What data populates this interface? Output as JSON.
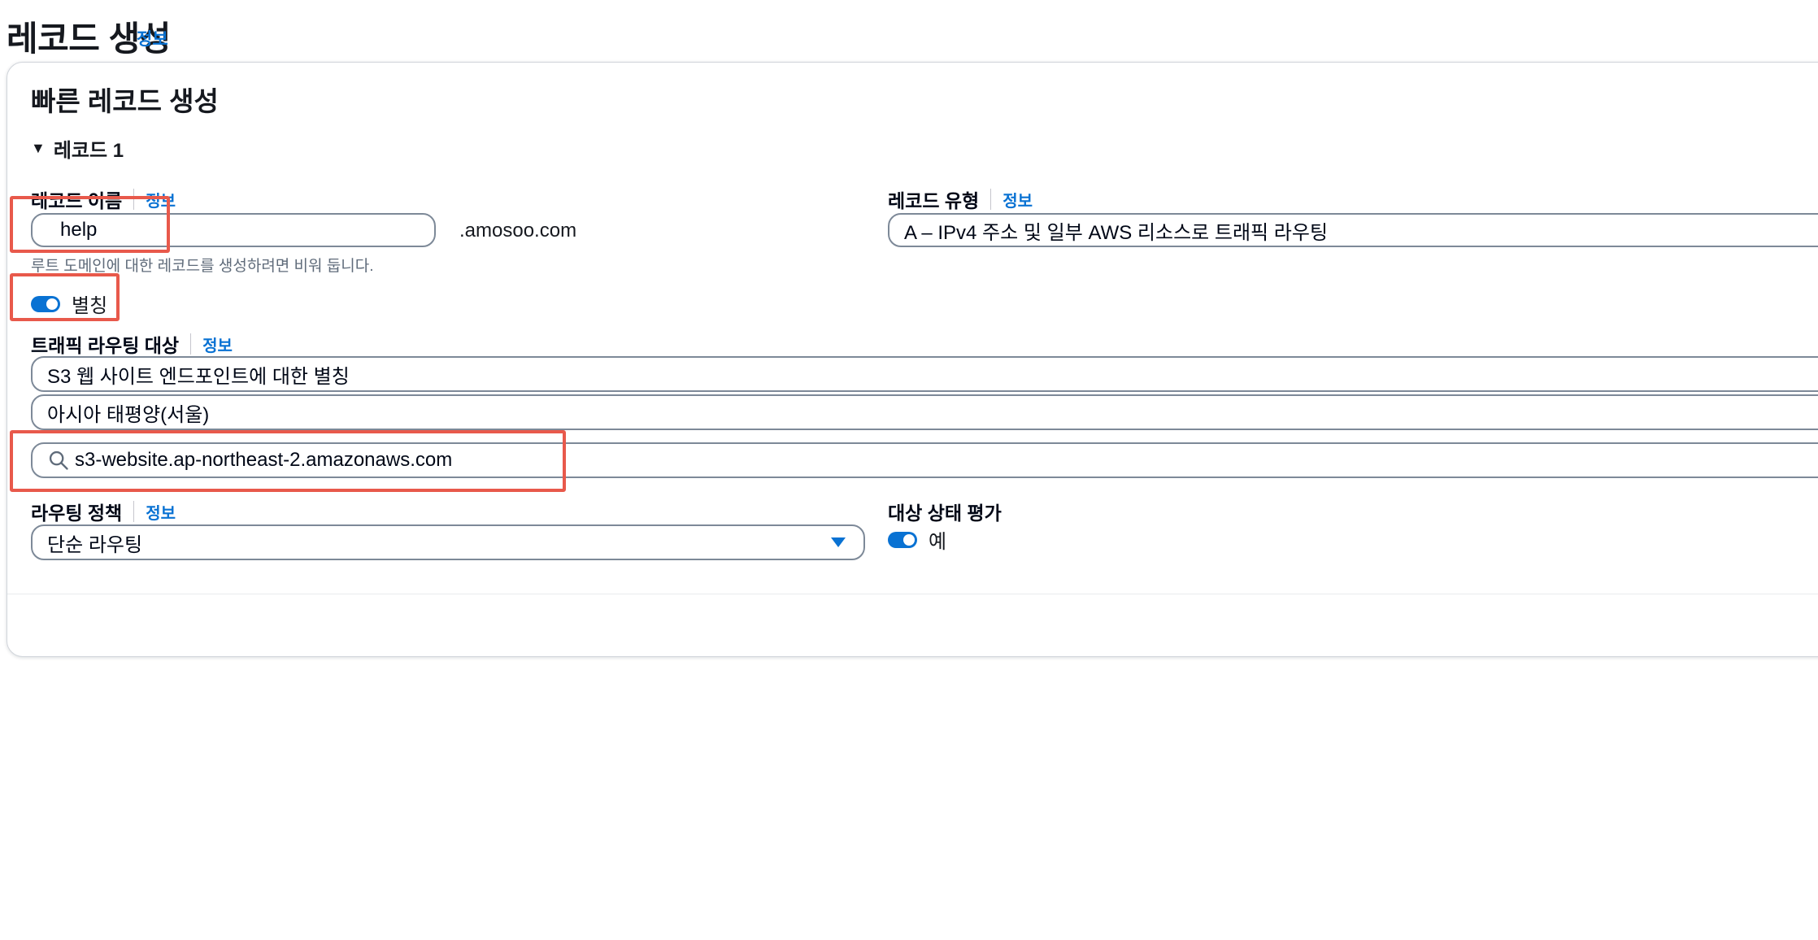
{
  "page": {
    "title": "레코드 생성",
    "info": "정보"
  },
  "quick_create": {
    "title": "빠른 레코드 생성",
    "record_label": "레코드 1"
  },
  "record_name": {
    "label": "레코드 이름",
    "info": "정보",
    "value": "help",
    "domain_suffix": ".amosoo.com",
    "hint": "루트 도메인에 대한 레코드를 생성하려면 비워 둡니다."
  },
  "record_type": {
    "label": "레코드 유형",
    "info": "정보",
    "value": "A – IPv4 주소 및 일부 AWS 리소스로 트래픽 라우팅"
  },
  "alias": {
    "label": "별칭",
    "enabled": true
  },
  "routing_target": {
    "label": "트래픽 라우팅 대상",
    "info": "정보",
    "endpoint_type": "S3 웹 사이트 엔드포인트에 대한 별칭",
    "region": "아시아 태평양(서울)",
    "endpoint_value": "s3-website.ap-northeast-2.amazonaws.com"
  },
  "routing_policy": {
    "label": "라우팅 정책",
    "info": "정보",
    "value": "단순 라우팅"
  },
  "health_eval": {
    "label": "대상 상태 평가",
    "toggle_label": "예",
    "enabled": true
  },
  "colors": {
    "link": "#0972d3",
    "toggle_on": "#0972d3",
    "highlight_box": "#e8594b"
  }
}
